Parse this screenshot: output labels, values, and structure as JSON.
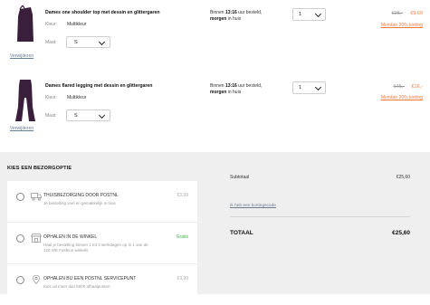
{
  "products": [
    {
      "name": "Dames one shoulder top met dessin en glittergaren",
      "color_label": "Kleur:",
      "color_value": "Multikleur",
      "size_label": "Maat:",
      "size_value": "S",
      "remove_label": "Verwijderen",
      "delivery_prefix": "Binnen",
      "delivery_time": "13:16",
      "delivery_suffix": "uur besteld,",
      "delivery_day": "morgen",
      "delivery_end": "in huis",
      "quantity": "1",
      "old_price": "€25,-",
      "new_price": "€9,60",
      "member_note": "Member 20% korting"
    },
    {
      "name": "Dames flared legging met dessin en glittergaren",
      "color_label": "Kleur:",
      "color_value": "Multikleur",
      "size_label": "Maat:",
      "size_value": "S",
      "remove_label": "Verwijderen",
      "delivery_prefix": "Binnen",
      "delivery_time": "13:16",
      "delivery_suffix": "uur besteld,",
      "delivery_day": "morgen",
      "delivery_end": "in huis",
      "quantity": "1",
      "old_price": "€45,-",
      "new_price": "€16,-",
      "member_note": "Member 20% korting"
    }
  ],
  "shipping": {
    "title": "KIES EEN BEZORGOPTIE",
    "options": [
      {
        "title": "THUISBEZORGING DOOR POSTNL",
        "desc": "Je bestelling snel en gemakkelijk in huis",
        "price": "€3,99",
        "icon": "truck-icon"
      },
      {
        "title": "OPHALEN IN DE WINKEL",
        "desc": "Haal je bestelling binnen 1 tot 3 werkdagen op in 1 van de 120 WE Fashion winkels",
        "price": "Gratis",
        "icon": "store-icon"
      },
      {
        "title": "OPHALEN BIJ EEN POSTNL SERVICEPUNT",
        "desc": "Kies uit meer dan 5000 afhaalpunten",
        "price": "€3,99",
        "icon": "location-pin-icon"
      }
    ]
  },
  "summary": {
    "subtotal_label": "Subtotaal",
    "subtotal_value": "€25,60",
    "discount_link": "Ik heb een kortingscode",
    "total_label": "TOTAAL",
    "total_value": "€25,60"
  },
  "colors": {
    "accent": "#f07a3c",
    "free": "#41b649",
    "link": "#6b7d93"
  }
}
